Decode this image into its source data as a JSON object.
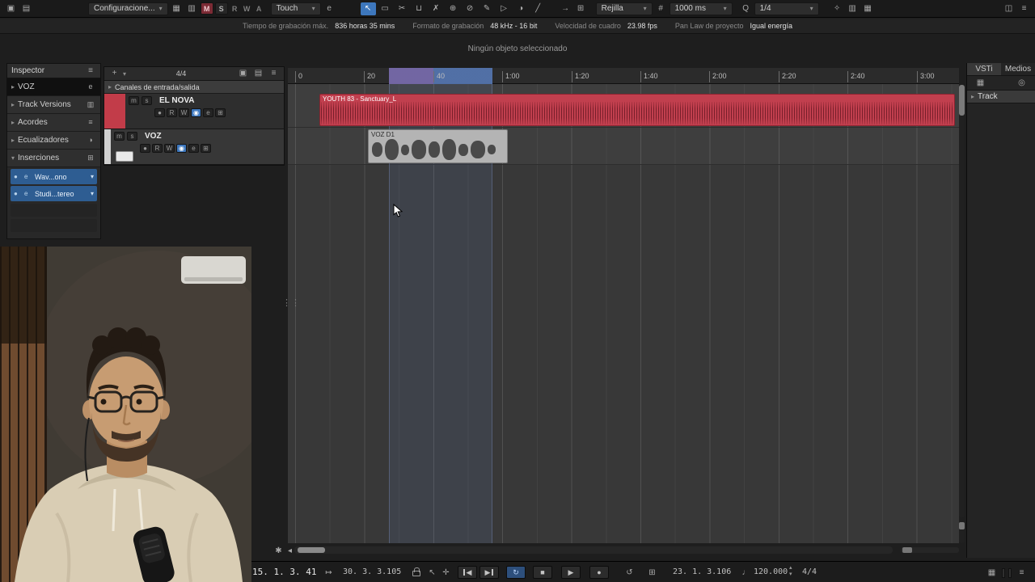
{
  "colors": {
    "accent_blue": "#3d77bd",
    "track_red": "#c23c49",
    "event_red": "#c13f4e",
    "cycle_purple": "#7a6db0",
    "cycle_blue": "#5577b3",
    "clip_gray": "#b4b4b4",
    "insert_blue": "#2e5d92",
    "toolbar_bg": "#1a1a1a",
    "hoodie_beige": "#d9cdb4"
  },
  "icons": {
    "window": "▣",
    "workspaces": "▤",
    "caret_down": "▾",
    "caret_right": "▸",
    "setup_window": "▦",
    "zones": "▥",
    "m": "M",
    "s": "S",
    "r": "R",
    "w": "W",
    "a": "A",
    "e": "e",
    "arrow_tool": "↖",
    "range_tool": "▭",
    "split_tool": "✂",
    "glue_tool": "⊔",
    "erase_tool": "✗",
    "zoom_tool": "⊕",
    "mute_tool": "⊘",
    "draw_tool": "✎",
    "play_tool": "▷",
    "color_tool": "◑",
    "line_tool": "╱",
    "autoscroll": "→",
    "snap": "⊞",
    "hash": "#",
    "q": "Q",
    "wand": "✧",
    "menu": "≡",
    "panels": "◫",
    "plus": "+",
    "camera": "▣",
    "visibility": "▤",
    "search": "◎",
    "rack": "▦",
    "gear": "✱",
    "arrow_left_small": "◂",
    "prev": "◀",
    "next": "▶",
    "cycle": "↻",
    "stop": "■",
    "play": "▶",
    "record": "●",
    "retro_record": "↺",
    "jump": "↦",
    "pointer": "↖",
    "crosshair": "✛",
    "note": "♩",
    "stepper_up": "▴",
    "stepper_down": "▾",
    "dots_vertical": "⋮⋮",
    "meter": "▮"
  },
  "toolbar": {
    "config_label": "Configuracione...",
    "automation_mode": "Touch",
    "grid_type": "Rejilla",
    "quantize_length": "1000 ms",
    "quantize_preset": "1/4"
  },
  "infobar": {
    "items": [
      {
        "label": "Tiempo de grabación máx.",
        "value": "836 horas 35 mins"
      },
      {
        "label": "Formato de grabación",
        "value": "48 kHz - 16 bit"
      },
      {
        "label": "Velocidad de cuadro",
        "value": "23.98 fps"
      },
      {
        "label": "Pan Law de proyecto",
        "value": "Igual energía"
      }
    ]
  },
  "status_line": "Ningún objeto seleccionado",
  "inspector": {
    "title": "Inspector",
    "sections": [
      {
        "label": "VOZ"
      },
      {
        "label": "Track Versions"
      },
      {
        "label": "Acordes"
      },
      {
        "label": "Ecualizadores"
      },
      {
        "label": "Inserciones"
      }
    ],
    "inserts": [
      {
        "label": "Wav...ono"
      },
      {
        "label": "Studi...tereo"
      }
    ]
  },
  "track_list": {
    "time_signature": "4/4",
    "io_channels_label": "Canales de entrada/salida",
    "tracks": [
      {
        "name": "EL NOVA"
      },
      {
        "name": "VOZ"
      }
    ],
    "buttons": {
      "mute": "m",
      "solo": "s",
      "record": "●",
      "monitor": "◉",
      "read": "R",
      "write": "W",
      "edit": "e",
      "lane": "⊞"
    }
  },
  "ruler_ticks": [
    "0",
    "20",
    "40",
    "1:00",
    "1:20",
    "1:40",
    "2:00",
    "2:20",
    "2:40",
    "3:00"
  ],
  "events": {
    "audio1": {
      "name": "YOUTH 83 - Sanctuary_L"
    },
    "audio2": {
      "name": "VOZ D1"
    }
  },
  "right_zone": {
    "tabs": [
      {
        "label": "VSTi"
      },
      {
        "label": "Medios"
      }
    ],
    "rack_item": "Track"
  },
  "transport": {
    "primary_time": "15. 1. 3. 41",
    "secondary_time": "30. 3. 3.105",
    "right_locator": "23. 1. 3.106",
    "tempo": "120.000",
    "time_signature": "4/4"
  }
}
